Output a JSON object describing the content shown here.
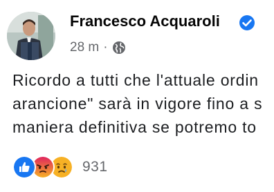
{
  "post": {
    "author_name": "Francesco Acquaroli",
    "time_ago": "28 m",
    "separator": "·",
    "visibility_icon": "globe-icon",
    "verified_icon": "verified-badge-icon",
    "text_lines": [
      "Ricordo a tutti che l'attuale ordin",
      "arancione\" sarà in vigore fino a s",
      "maniera definitiva se potremo to"
    ]
  },
  "reactions": {
    "icons": [
      "like-icon",
      "angry-icon",
      "sad-icon"
    ],
    "count": "931"
  },
  "colors": {
    "verified_blue": "#1877f2",
    "like_blue": "#1877f2",
    "angry_orange": "#e9710f",
    "sad_yellow": "#f7b125",
    "secondary_text": "#65676b"
  }
}
